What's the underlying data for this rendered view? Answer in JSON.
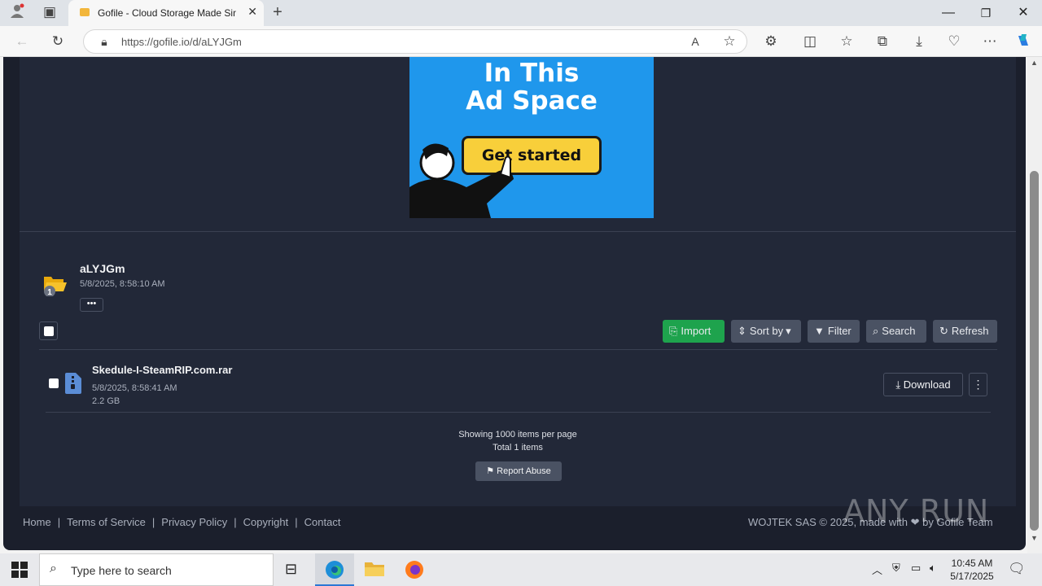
{
  "browser": {
    "tab_title": "Gofile - Cloud Storage Made Sim",
    "url": "https://gofile.io/d/aLYJGm"
  },
  "ad": {
    "line1": "In This",
    "line2": "Ad Space",
    "button": "Get started"
  },
  "folder": {
    "name": "aLYJGm",
    "date": "5/8/2025, 8:58:10 AM",
    "badge": "1",
    "more": "•••"
  },
  "actions": {
    "import": "Import",
    "sort_by": "Sort by",
    "filter": "Filter",
    "search": "Search",
    "refresh": "Refresh"
  },
  "file": {
    "name": "Skedule-I-SteamRIP.com.rar",
    "date": "5/8/2025, 8:58:41 AM",
    "size": "2.2 GB",
    "download": "Download"
  },
  "listing": {
    "per_page": "Showing 1000 items per page",
    "total": "Total 1 items",
    "report": "Report Abuse"
  },
  "footer": {
    "links": [
      "Home",
      "Terms of Service",
      "Privacy Policy",
      "Copyright",
      "Contact"
    ],
    "copyright": "WOJTEK SAS © 2025, made with ❤ by Gofile Team"
  },
  "watermark": "ANY RUN",
  "taskbar": {
    "search_placeholder": "Type here to search",
    "time": "10:45 AM",
    "date": "5/17/2025"
  },
  "colors": {
    "page_bg": "#1b1f2c",
    "panel_bg": "#222838",
    "import_green": "#1ea34d",
    "button_gray": "#4a5263",
    "ad_blue": "#1f97ec"
  }
}
